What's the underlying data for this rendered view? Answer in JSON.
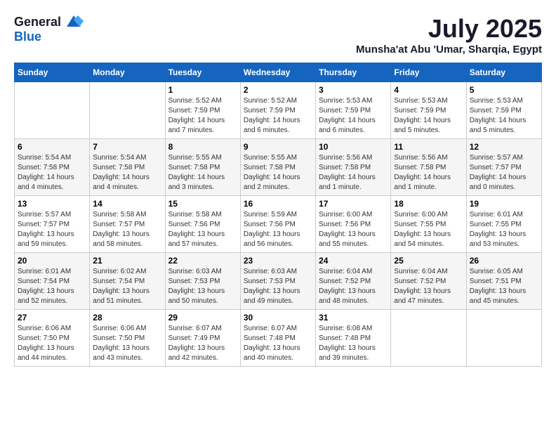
{
  "header": {
    "logo_general": "General",
    "logo_blue": "Blue",
    "month_title": "July 2025",
    "location": "Munsha'at Abu 'Umar, Sharqia, Egypt"
  },
  "weekdays": [
    "Sunday",
    "Monday",
    "Tuesday",
    "Wednesday",
    "Thursday",
    "Friday",
    "Saturday"
  ],
  "weeks": [
    [
      {
        "day": "",
        "info": ""
      },
      {
        "day": "",
        "info": ""
      },
      {
        "day": "1",
        "info": "Sunrise: 5:52 AM\nSunset: 7:59 PM\nDaylight: 14 hours and 7 minutes."
      },
      {
        "day": "2",
        "info": "Sunrise: 5:52 AM\nSunset: 7:59 PM\nDaylight: 14 hours and 6 minutes."
      },
      {
        "day": "3",
        "info": "Sunrise: 5:53 AM\nSunset: 7:59 PM\nDaylight: 14 hours and 6 minutes."
      },
      {
        "day": "4",
        "info": "Sunrise: 5:53 AM\nSunset: 7:59 PM\nDaylight: 14 hours and 5 minutes."
      },
      {
        "day": "5",
        "info": "Sunrise: 5:53 AM\nSunset: 7:59 PM\nDaylight: 14 hours and 5 minutes."
      }
    ],
    [
      {
        "day": "6",
        "info": "Sunrise: 5:54 AM\nSunset: 7:58 PM\nDaylight: 14 hours and 4 minutes."
      },
      {
        "day": "7",
        "info": "Sunrise: 5:54 AM\nSunset: 7:58 PM\nDaylight: 14 hours and 4 minutes."
      },
      {
        "day": "8",
        "info": "Sunrise: 5:55 AM\nSunset: 7:58 PM\nDaylight: 14 hours and 3 minutes."
      },
      {
        "day": "9",
        "info": "Sunrise: 5:55 AM\nSunset: 7:58 PM\nDaylight: 14 hours and 2 minutes."
      },
      {
        "day": "10",
        "info": "Sunrise: 5:56 AM\nSunset: 7:58 PM\nDaylight: 14 hours and 1 minute."
      },
      {
        "day": "11",
        "info": "Sunrise: 5:56 AM\nSunset: 7:58 PM\nDaylight: 14 hours and 1 minute."
      },
      {
        "day": "12",
        "info": "Sunrise: 5:57 AM\nSunset: 7:57 PM\nDaylight: 14 hours and 0 minutes."
      }
    ],
    [
      {
        "day": "13",
        "info": "Sunrise: 5:57 AM\nSunset: 7:57 PM\nDaylight: 13 hours and 59 minutes."
      },
      {
        "day": "14",
        "info": "Sunrise: 5:58 AM\nSunset: 7:57 PM\nDaylight: 13 hours and 58 minutes."
      },
      {
        "day": "15",
        "info": "Sunrise: 5:58 AM\nSunset: 7:56 PM\nDaylight: 13 hours and 57 minutes."
      },
      {
        "day": "16",
        "info": "Sunrise: 5:59 AM\nSunset: 7:56 PM\nDaylight: 13 hours and 56 minutes."
      },
      {
        "day": "17",
        "info": "Sunrise: 6:00 AM\nSunset: 7:56 PM\nDaylight: 13 hours and 55 minutes."
      },
      {
        "day": "18",
        "info": "Sunrise: 6:00 AM\nSunset: 7:55 PM\nDaylight: 13 hours and 54 minutes."
      },
      {
        "day": "19",
        "info": "Sunrise: 6:01 AM\nSunset: 7:55 PM\nDaylight: 13 hours and 53 minutes."
      }
    ],
    [
      {
        "day": "20",
        "info": "Sunrise: 6:01 AM\nSunset: 7:54 PM\nDaylight: 13 hours and 52 minutes."
      },
      {
        "day": "21",
        "info": "Sunrise: 6:02 AM\nSunset: 7:54 PM\nDaylight: 13 hours and 51 minutes."
      },
      {
        "day": "22",
        "info": "Sunrise: 6:03 AM\nSunset: 7:53 PM\nDaylight: 13 hours and 50 minutes."
      },
      {
        "day": "23",
        "info": "Sunrise: 6:03 AM\nSunset: 7:53 PM\nDaylight: 13 hours and 49 minutes."
      },
      {
        "day": "24",
        "info": "Sunrise: 6:04 AM\nSunset: 7:52 PM\nDaylight: 13 hours and 48 minutes."
      },
      {
        "day": "25",
        "info": "Sunrise: 6:04 AM\nSunset: 7:52 PM\nDaylight: 13 hours and 47 minutes."
      },
      {
        "day": "26",
        "info": "Sunrise: 6:05 AM\nSunset: 7:51 PM\nDaylight: 13 hours and 45 minutes."
      }
    ],
    [
      {
        "day": "27",
        "info": "Sunrise: 6:06 AM\nSunset: 7:50 PM\nDaylight: 13 hours and 44 minutes."
      },
      {
        "day": "28",
        "info": "Sunrise: 6:06 AM\nSunset: 7:50 PM\nDaylight: 13 hours and 43 minutes."
      },
      {
        "day": "29",
        "info": "Sunrise: 6:07 AM\nSunset: 7:49 PM\nDaylight: 13 hours and 42 minutes."
      },
      {
        "day": "30",
        "info": "Sunrise: 6:07 AM\nSunset: 7:48 PM\nDaylight: 13 hours and 40 minutes."
      },
      {
        "day": "31",
        "info": "Sunrise: 6:08 AM\nSunset: 7:48 PM\nDaylight: 13 hours and 39 minutes."
      },
      {
        "day": "",
        "info": ""
      },
      {
        "day": "",
        "info": ""
      }
    ]
  ]
}
